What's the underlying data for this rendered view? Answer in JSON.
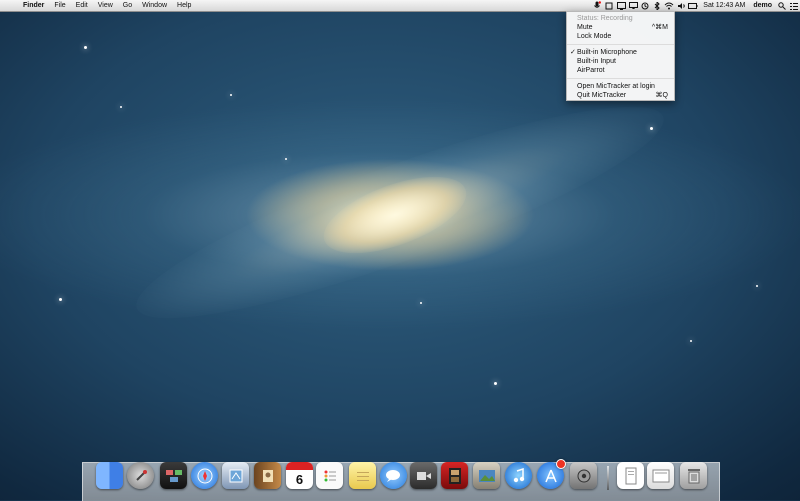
{
  "menubar": {
    "apple_glyph": "",
    "app_name": "Finder",
    "items": [
      "File",
      "Edit",
      "View",
      "Go",
      "Window",
      "Help"
    ],
    "clock": "Sat 12:43 AM",
    "user": "demo"
  },
  "mic_menu": {
    "status": "Status: Recording",
    "mute": "Mute",
    "mute_shortcut": "^⌘M",
    "lock_mode": "Lock Mode",
    "built_in_microphone": "Built-in Microphone",
    "built_in_input": "Built-in Input",
    "airparrot": "AirParrot",
    "open_at_login": "Open MicTracker at login",
    "quit": "Quit MicTracker",
    "quit_shortcut": "⌘Q",
    "checkmark": "✓"
  },
  "dock": {
    "calendar_day": "6",
    "icons": [
      "finder-icon",
      "launchpad-icon",
      "mission-control-icon",
      "safari-icon",
      "mail-icon",
      "contacts-icon",
      "calendar-icon",
      "reminders-icon",
      "notes-icon",
      "messages-icon",
      "facetime-icon",
      "photo-booth-icon",
      "iphoto-icon",
      "itunes-icon",
      "app-store-icon",
      "system-preferences-icon",
      "document-icon",
      "preview-icon",
      "trash-icon"
    ]
  },
  "colors": {
    "accent_red": "#e11",
    "menubar_text": "#111"
  }
}
